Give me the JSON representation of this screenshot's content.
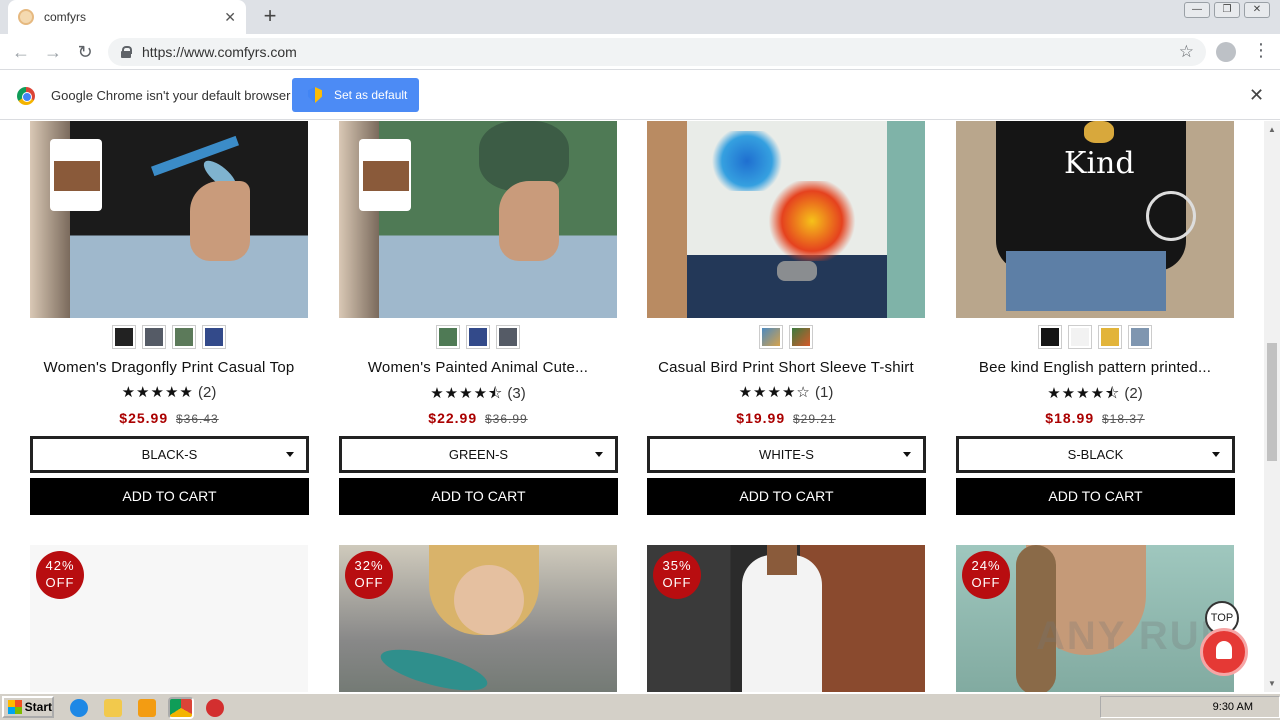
{
  "browser": {
    "tab_title": "comfyrs",
    "tab_close": "✕",
    "new_tab": "+",
    "url": "https://www.comfyrs.com",
    "window_buttons": [
      "—",
      "❐",
      "✕"
    ],
    "nav": {
      "back": "←",
      "forward": "→",
      "reload": "↻"
    },
    "star": "☆",
    "menu": "⋮"
  },
  "infobar": {
    "message": "Google Chrome isn't your default browser",
    "button": "Set as default",
    "close": "✕"
  },
  "products": [
    {
      "name": "Women's Dragonfly Print Casual Top",
      "stars": "★★★★★",
      "reviews": "(2)",
      "price": "$25.99",
      "old_price": "$36.43",
      "option": "BLACK-S",
      "cart": "ADD TO CART"
    },
    {
      "name": "Women's Painted Animal Cute...",
      "stars": "★★★★⯪",
      "reviews": "(3)",
      "price": "$22.99",
      "old_price": "$36.99",
      "option": "GREEN-S",
      "cart": "ADD TO CART"
    },
    {
      "name": "Casual Bird Print Short Sleeve T-shirt",
      "stars": "★★★★☆",
      "reviews": "(1)",
      "price": "$19.99",
      "old_price": "$29.21",
      "option": "WHITE-S",
      "cart": "ADD TO CART"
    },
    {
      "name": "Bee kind English pattern printed...",
      "stars": "★★★★⯪",
      "reviews": "(2)",
      "price": "$18.99",
      "old_price": "$18.37",
      "option": "S-BLACK",
      "cart": "ADD TO CART"
    }
  ],
  "product_image_text": {
    "bee_kind": "Kind"
  },
  "next_row": [
    {
      "pct": "42%",
      "off": "OFF"
    },
    {
      "pct": "32%",
      "off": "OFF"
    },
    {
      "pct": "35%",
      "off": "OFF"
    },
    {
      "pct": "24%",
      "off": "OFF"
    }
  ],
  "floating": {
    "top": "TOP",
    "watermark": "ANY RUN"
  },
  "taskbar": {
    "start": "Start",
    "clock": "9:30 AM"
  },
  "colors": {
    "sale_red": "#b80d10",
    "price_red": "#a00000",
    "cart_black": "#000000",
    "chrome_blue": "#4c8bf5"
  }
}
